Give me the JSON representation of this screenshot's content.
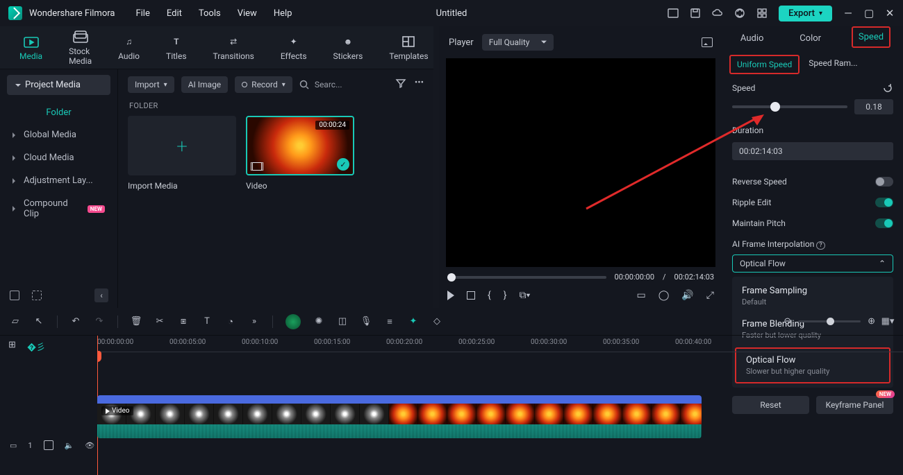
{
  "app": {
    "name": "Wondershare Filmora",
    "document": "Untitled",
    "export": "Export"
  },
  "menu": [
    "File",
    "Edit",
    "Tools",
    "View",
    "Help"
  ],
  "topTabs": [
    "Media",
    "Stock Media",
    "Audio",
    "Titles",
    "Transitions",
    "Effects",
    "Stickers",
    "Templates"
  ],
  "sidebar": {
    "pill": "Project Media",
    "active": "Folder",
    "items": [
      "Global Media",
      "Cloud Media",
      "Adjustment Lay...",
      "Compound Clip"
    ],
    "badgeOn": 3,
    "badgeText": "NEW"
  },
  "toolbar": {
    "import": "Import",
    "ai": "AI Image",
    "record": "Record",
    "search": "Searc..."
  },
  "folder": {
    "heading": "FOLDER",
    "importLabel": "Import Media",
    "videoLabel": "Video",
    "duration": "00:00:24"
  },
  "player": {
    "label": "Player",
    "quality": "Full Quality",
    "current": "00:00:00:00",
    "sep": "/",
    "total": "00:02:14:03"
  },
  "panelTabs": [
    "Audio",
    "Color",
    "Speed"
  ],
  "speed": {
    "subTabs": [
      "Uniform Speed",
      "Speed Ram..."
    ],
    "speedLabel": "Speed",
    "speedValue": "0.18",
    "durationLabel": "Duration",
    "durationValue": "00:02:14:03",
    "reverse": "Reverse Speed",
    "ripple": "Ripple Edit",
    "pitch": "Maintain Pitch",
    "interpLabel": "AI Frame Interpolation",
    "ddValue": "Optical Flow",
    "options": [
      {
        "t": "Frame Sampling",
        "s": "Default"
      },
      {
        "t": "Frame Blending",
        "s": "Faster but lower quality"
      },
      {
        "t": "Optical Flow",
        "s": "Slower but higher quality"
      }
    ],
    "reset": "Reset",
    "keyframe": "Keyframe Panel",
    "newBadge": "NEW"
  },
  "timeline": {
    "ticks": [
      "00:00:00:00",
      "00:00:05:00",
      "00:00:10:00",
      "00:00:15:00",
      "00:00:20:00",
      "00:00:25:00",
      "00:00:30:00",
      "00:00:35:00",
      "00:00:40:00"
    ],
    "clipLabel": "Video",
    "trackNum": "1"
  }
}
